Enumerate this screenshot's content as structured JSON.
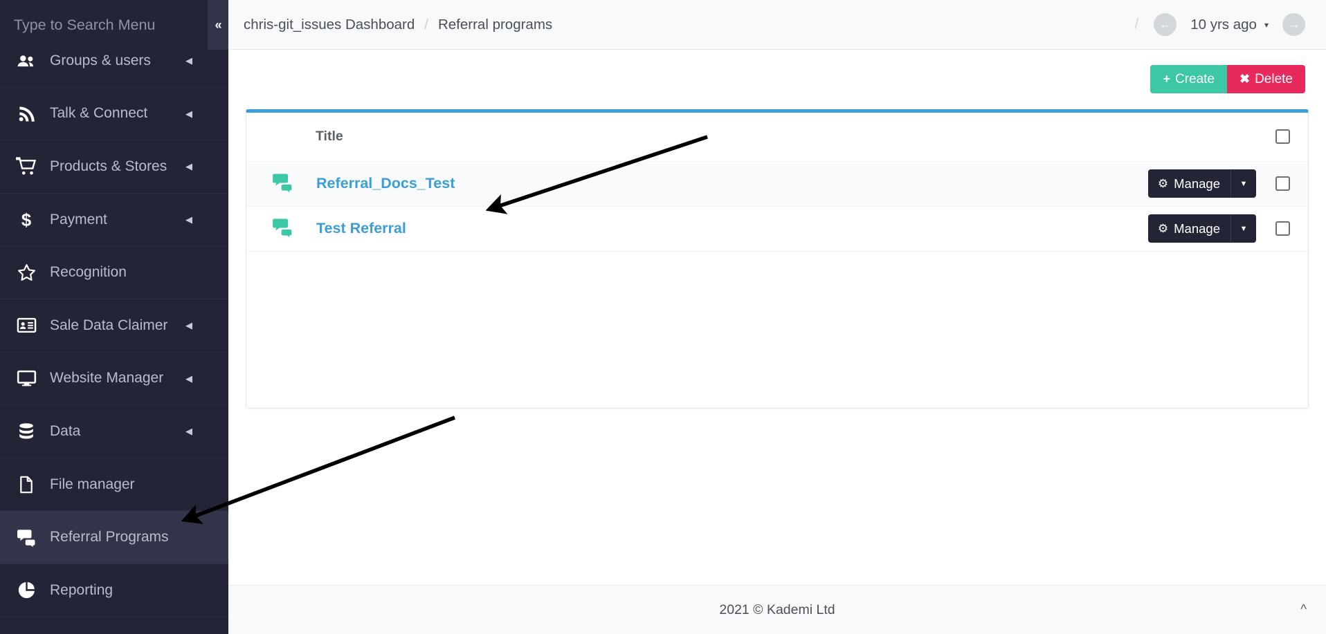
{
  "sidebar": {
    "search": {
      "placeholder": "Type to Search Menu",
      "value": ""
    },
    "collapse_label": "«",
    "items": [
      {
        "label": "Groups & users",
        "icon": "users-icon",
        "has_caret": true,
        "active": false
      },
      {
        "label": "Talk & Connect",
        "icon": "rss-icon",
        "has_caret": true,
        "active": false
      },
      {
        "label": "Products & Stores",
        "icon": "shopping-cart-icon",
        "has_caret": true,
        "active": false
      },
      {
        "label": "Payment",
        "icon": "dollar-icon",
        "has_caret": true,
        "active": false
      },
      {
        "label": "Recognition",
        "icon": "star-icon",
        "has_caret": false,
        "active": false
      },
      {
        "label": "Sale Data Claimer",
        "icon": "id-card-icon",
        "has_caret": true,
        "active": false
      },
      {
        "label": "Website Manager",
        "icon": "desktop-icon",
        "has_caret": true,
        "active": false
      },
      {
        "label": "Data",
        "icon": "database-icon",
        "has_caret": true,
        "active": false
      },
      {
        "label": "File manager",
        "icon": "file-icon",
        "has_caret": false,
        "active": false
      },
      {
        "label": "Referral Programs",
        "icon": "comments-icon",
        "has_caret": false,
        "active": true
      },
      {
        "label": "Reporting",
        "icon": "pie-chart-icon",
        "has_caret": false,
        "active": false
      }
    ]
  },
  "topbar": {
    "breadcrumb": [
      "chris-git_issues Dashboard",
      "Referral programs"
    ],
    "breadcrumb_separator": "/",
    "right_separator": "/",
    "prev_label": "←",
    "next_label": "→",
    "date_label": "10 yrs ago",
    "date_caret": "▾"
  },
  "actions": {
    "create_label": "Create",
    "create_icon": "plus-icon",
    "create_color": "#3cc7a5",
    "delete_label": "Delete",
    "delete_icon": "times-icon",
    "delete_color": "#e8295c"
  },
  "table": {
    "columns": {
      "icon": "",
      "title": "Title",
      "action": "",
      "select": ""
    },
    "select_all_checked": false,
    "rows": [
      {
        "icon": "comments-icon",
        "title": "Referral_Docs_Test",
        "manage_label": "Manage",
        "manage_icon": "gear-icon",
        "checked": false
      },
      {
        "icon": "comments-icon",
        "title": "Test Referral",
        "manage_label": "Manage",
        "manage_icon": "gear-icon",
        "checked": false
      }
    ]
  },
  "footer": {
    "text": "2021 © Kademi Ltd",
    "scroll_top_icon": "chevron-up-icon"
  },
  "theme": {
    "sidebar_bg": "#232536",
    "sidebar_active_bg": "#32344a",
    "card_accent": "#3c9ed8",
    "link_color": "#3c9ed8",
    "accent_teal": "#3cc7a5",
    "accent_pink": "#e8295c"
  }
}
